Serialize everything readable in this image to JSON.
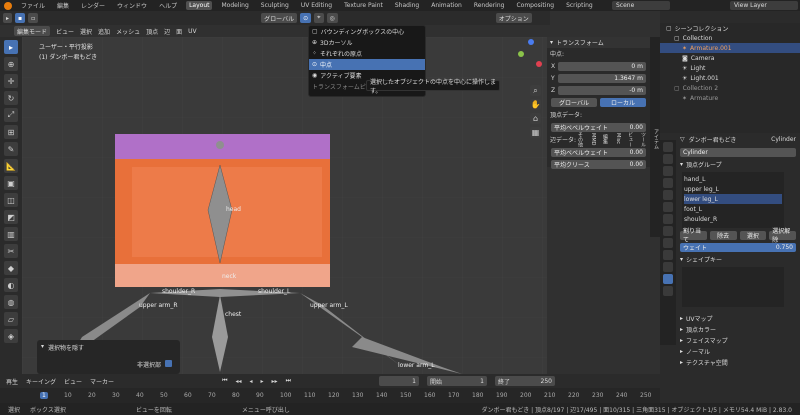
{
  "topbar": {
    "menus": [
      "ファイル",
      "編集",
      "レンダー",
      "ウィンドウ",
      "ヘルプ"
    ],
    "tabs": [
      "Layout",
      "Modeling",
      "Sculpting",
      "UV Editing",
      "Texture Paint",
      "Shading",
      "Animation",
      "Rendering",
      "Compositing",
      "Scripting"
    ],
    "scene": "Scene",
    "view_layer": "View Layer"
  },
  "header": {
    "mode": "編集モード",
    "menus": [
      "ビュー",
      "選択",
      "追加",
      "メッシュ",
      "頂点",
      "辺",
      "面",
      "UV"
    ],
    "transform_orient": "グローバル",
    "options": "オプション"
  },
  "viewport": {
    "view_name": "ユーザー・平行投影",
    "object_name": "(1) ダンボー君もどき",
    "bones": [
      "head",
      "neck",
      "shoulder_R",
      "shoulder_L",
      "upper arm_R",
      "upper arm_L",
      "chest",
      "lower arm_L"
    ]
  },
  "pivot_menu": {
    "items": [
      "バウンディングボックスの中心",
      "3Dカーソル",
      "それぞれの原点",
      "中点",
      "アクティブ要素"
    ],
    "highlighted": "中点",
    "footer": "トランスフォームピ",
    "tooltip": "選択したオブジェクトの中点を中心に操作します。"
  },
  "npanel": {
    "title": "トランスフォーム",
    "median": "中点:",
    "x_label": "X",
    "x": "0 m",
    "y_label": "Y",
    "y": "1.3647 m",
    "z_label": "Z",
    "z": "-0 m",
    "global": "グローバル",
    "local": "ローカル",
    "vertex_data": "頂点データ:",
    "bevel_weight": "平均ベベルウェイト",
    "bevel_val": "0.00",
    "edge_data": "辺データ:",
    "edge_bevel": "平均ベベルウェイト",
    "edge_bevel_val": "0.00",
    "crease": "平均クリース",
    "crease_val": "0.00",
    "tabs": [
      "アイテム",
      "ツール",
      "ビュー",
      "Misc",
      "編集",
      "MMD",
      "その他"
    ]
  },
  "outliner": {
    "title": "シーンコレクション",
    "items": [
      "Collection",
      "Armature.001",
      "Camera",
      "Light",
      "Light.001",
      "Collection 2",
      "Armature"
    ]
  },
  "props": {
    "object_name": "ダンボー君もどき",
    "mesh_name": "Cylinder",
    "data_name": "Cylinder",
    "vertex_groups": "頂点グループ",
    "groups": [
      "hand_L",
      "upper leg_L",
      "lower leg_L",
      "foot_L",
      "shoulder_R"
    ],
    "assign": "割り当て",
    "remove": "除去",
    "select": "選択",
    "deselect": "選択解除",
    "weight_label": "ウェイト",
    "weight": "0.750",
    "shape_keys": "シェイプキー",
    "sections": [
      "UVマップ",
      "頂点カラー",
      "フェイスマップ",
      "ノーマル",
      "テクスチャ空間"
    ]
  },
  "redo": {
    "title": "選択物を隠す",
    "checkbox": "非選択部"
  },
  "timeline": {
    "menus": [
      "再生",
      "キーイング",
      "ビュー",
      "マーカー"
    ],
    "current": "1",
    "start_label": "開始",
    "start": "1",
    "end_label": "終了",
    "end": "250",
    "ticks": [
      "1",
      "10",
      "20",
      "30",
      "40",
      "50",
      "60",
      "70",
      "80",
      "90",
      "100",
      "110",
      "120",
      "130",
      "140",
      "150",
      "160",
      "170",
      "180",
      "190",
      "200",
      "210",
      "220",
      "230",
      "240",
      "250"
    ]
  },
  "status": {
    "items": [
      "選択",
      "ボックス選択",
      "ビューを回転",
      "メニュー呼び出し"
    ],
    "stats": "ダンボー君もどき | 頂点8/197 | 辺17/495 | 面10/315 | 三角面315 | オブジェクト1/5 | メモリ54.4 MiB | 2.83.0"
  }
}
